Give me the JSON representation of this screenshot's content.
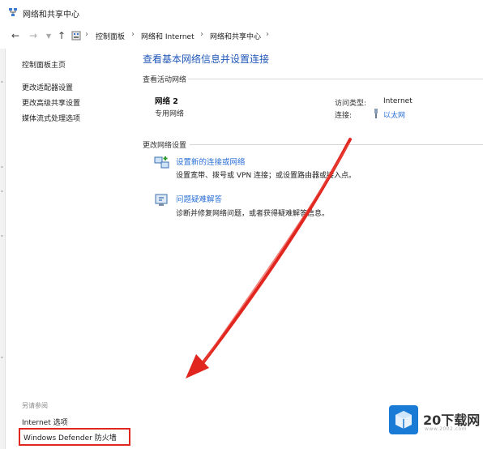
{
  "window": {
    "title": "网络和共享中心"
  },
  "address_bar": {
    "back_icon": "arrow-left-icon",
    "breadcrumbs": [
      "控制面板",
      "网络和 Internet",
      "网络和共享中心"
    ]
  },
  "sidebar": {
    "home": "控制面板主页",
    "links": [
      "更改适配器设置",
      "更改高级共享设置",
      "媒体流式处理选项"
    ],
    "see_also_label": "另请参阅",
    "see_also": [
      "Internet 选项",
      "Windows Defender 防火墙"
    ]
  },
  "main": {
    "title": "查看基本网络信息并设置连接",
    "active_label": "查看活动网络",
    "network": {
      "name": "网络 2",
      "type": "专用网络",
      "access_label": "访问类型:",
      "access_value": "Internet",
      "connections_label": "连接:",
      "connections_value": "以太网"
    },
    "change_label": "更改网络设置",
    "tasks": [
      {
        "link": "设置新的连接或网络",
        "desc": "设置宽带、拨号或 VPN 连接；或设置路由器或接入点。"
      },
      {
        "link": "问题疑难解答",
        "desc": "诊断并修复网络问题，或者获得疑难解答信息。"
      }
    ]
  },
  "watermark": {
    "text": "20下载网",
    "sub": "www.2002.com"
  },
  "colors": {
    "link": "#2a6fd6",
    "title_blue": "#1f57b8",
    "annotation_red": "#e0261e"
  }
}
